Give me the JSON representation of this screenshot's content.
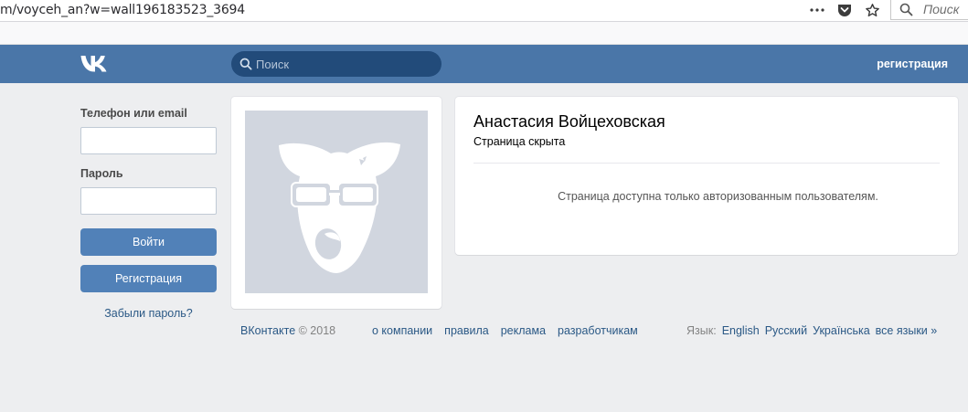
{
  "browser": {
    "url_prefix": "m",
    "url_path": "/voyceh_an?w=wall196183523_3694",
    "search_placeholder": "Поиск",
    "icons": [
      "more-icon",
      "pocket-icon",
      "bookmark-star-icon"
    ]
  },
  "header": {
    "search_placeholder": "Поиск",
    "register_link": "регистрация"
  },
  "login": {
    "phone_label": "Телефон или email",
    "phone_value": "",
    "password_label": "Пароль",
    "password_value": "",
    "login_button": "Войти",
    "register_button": "Регистрация",
    "forgot_link": "Забыли пароль?"
  },
  "profile": {
    "name": "Анастасия Войцеховская",
    "status": "Страница скрыта",
    "notice": "Страница доступна только авторизованным пользователям."
  },
  "footer": {
    "brand": "ВКонтакте",
    "copyright": " © 2018",
    "links": [
      "о компании",
      "правила",
      "реклама",
      "разработчикам"
    ],
    "language_label": "Язык:",
    "languages": [
      "English",
      "Русский",
      "Українська",
      "все языки »"
    ]
  },
  "colors": {
    "header_bg": "#4a76a8",
    "search_bg": "#224b7a",
    "button_bg": "#5181b8",
    "link": "#2a5885",
    "page_bg": "#edeef0",
    "avatar_bg": "#d1d6df"
  }
}
